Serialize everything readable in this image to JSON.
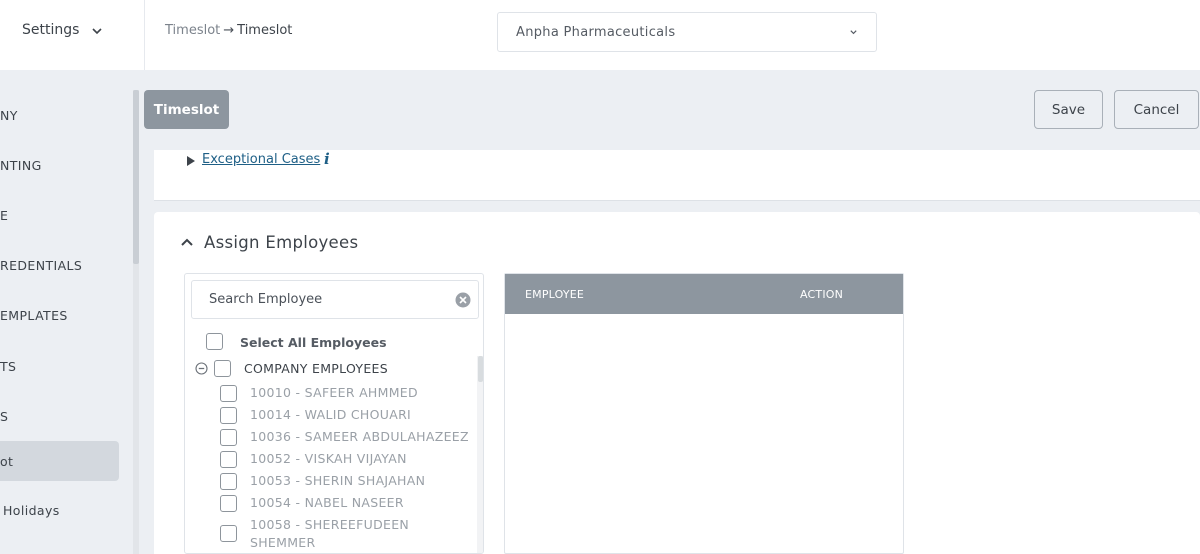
{
  "topbar": {
    "settings_label": "Settings",
    "breadcrumb": {
      "parent": "Timeslot",
      "arrow": "→",
      "current": "Timeslot"
    },
    "company_select": {
      "value": "Anpha Pharmaceuticals"
    }
  },
  "sidebar": {
    "items": [
      {
        "label": "NY"
      },
      {
        "label": "NTING"
      },
      {
        "label": "E"
      },
      {
        "label": "REDENTIALS"
      },
      {
        "label": "EMPLATES"
      },
      {
        "label": "TS"
      },
      {
        "label": "S"
      },
      {
        "label": "ot",
        "active": true
      },
      {
        "label": "Holidays"
      }
    ]
  },
  "header": {
    "tab_label": "Timeslot",
    "save_label": "Save",
    "cancel_label": "Cancel"
  },
  "exceptional": {
    "link_label": "Exceptional Cases",
    "info_glyph": "i"
  },
  "assign": {
    "title": "Assign Employees",
    "search_placeholder": "Search Employee",
    "select_all_label": "Select All Employees",
    "group_label": "COMPANY EMPLOYEES",
    "employees": [
      "10010 - SAFEER AHMMED",
      "10014 - WALID CHOUARI",
      "10036 - SAMEER ABDULAHAZEEZ",
      "10052 - VISKAH VIJAYAN",
      "10053 - SHERIN SHAJAHAN",
      "10054 - NABEL NASEER",
      "10058 - SHEREEFUDEEN SHEMMER"
    ],
    "table_columns": [
      "EMPLOYEE",
      "ACTION"
    ]
  },
  "colors": {
    "accent_gray": "#8d969f",
    "link_blue": "#1e5f86",
    "background": "#eceff3"
  }
}
